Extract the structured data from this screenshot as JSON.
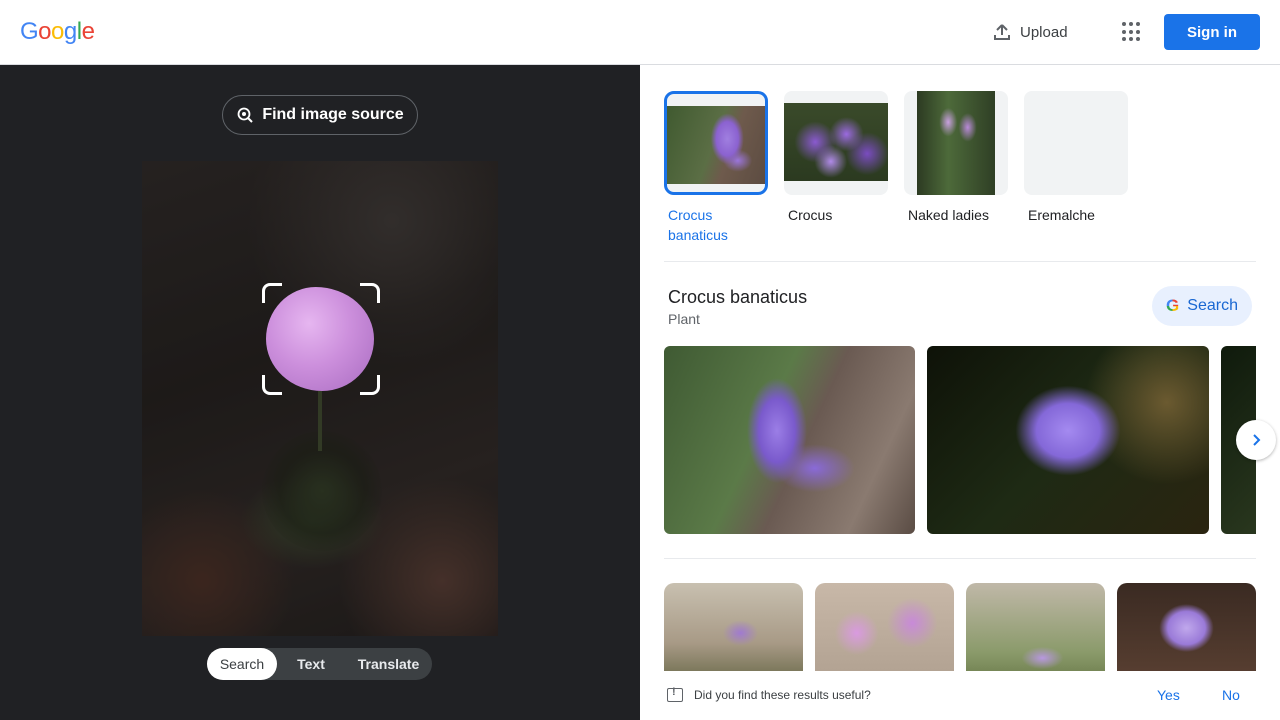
{
  "header": {
    "logo_letters": [
      {
        "ch": "G",
        "color": "#4285f4"
      },
      {
        "ch": "o",
        "color": "#ea4335"
      },
      {
        "ch": "o",
        "color": "#fbbc05"
      },
      {
        "ch": "g",
        "color": "#4285f4"
      },
      {
        "ch": "l",
        "color": "#34a853"
      },
      {
        "ch": "e",
        "color": "#ea4335"
      }
    ],
    "upload_label": "Upload",
    "apps_icon": "apps-grid-icon",
    "signin_label": "Sign in"
  },
  "lens": {
    "find_source_label": "Find image source",
    "modes": [
      "Search",
      "Text",
      "Translate"
    ],
    "active_mode": "Search"
  },
  "results": {
    "chips": [
      {
        "label": "Crocus banaticus",
        "selected": true
      },
      {
        "label": "Crocus",
        "selected": false
      },
      {
        "label": "Naked ladies",
        "selected": false
      },
      {
        "label": "Eremalche",
        "selected": false
      }
    ],
    "entity": {
      "title": "Crocus banaticus",
      "subtitle": "Plant",
      "search_label": "Search"
    },
    "feedback": {
      "question": "Did you find these results useful?",
      "yes": "Yes",
      "no": "No"
    }
  },
  "colors": {
    "accent": "#1a73e8",
    "dark_panel": "#202124"
  }
}
